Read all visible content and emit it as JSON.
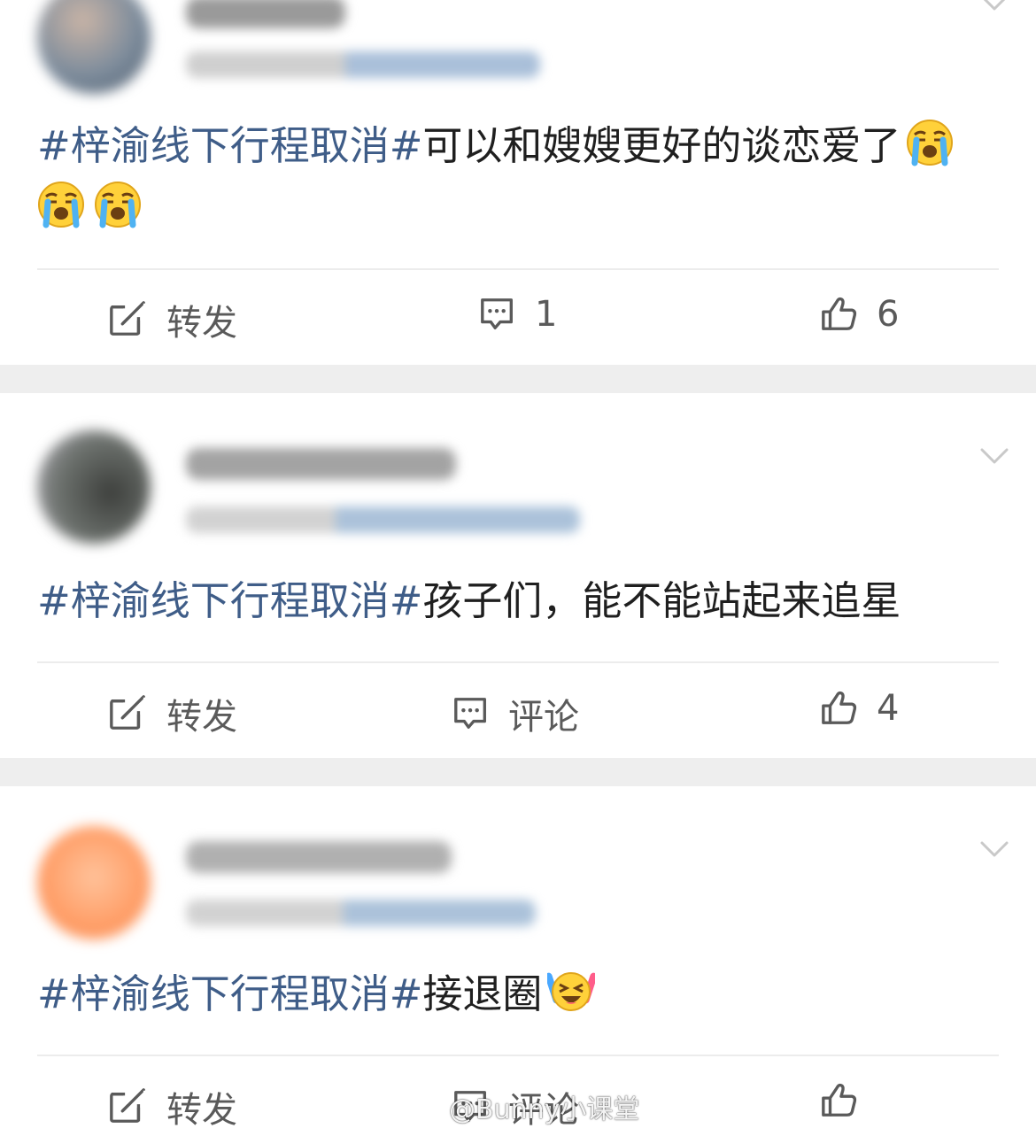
{
  "posts": [
    {
      "topic": "#梓渝线下行程取消#",
      "text": "可以和嫂嫂更好的谈恋爱了",
      "emojis": [
        "crying-face",
        "crying-face",
        "crying-face"
      ],
      "actions": {
        "repost": "转发",
        "comment": "1",
        "like": "6"
      }
    },
    {
      "topic": "#梓渝线下行程取消#",
      "text": "孩子们，能不能站起来追星",
      "actions": {
        "repost": "转发",
        "comment": "评论",
        "like": "4"
      }
    },
    {
      "topic": "#梓渝线下行程取消#",
      "text": "接退圈",
      "emojis": [
        "excited-face-with-glowsticks"
      ],
      "actions": {
        "repost": "转发",
        "comment": "评论"
      }
    }
  ],
  "watermark": "@Bunny小课堂",
  "colors": {
    "topic": "#3f5d88",
    "text": "#1f1f1f",
    "action": "#5a5a5a",
    "separator": "#eeeeee"
  }
}
